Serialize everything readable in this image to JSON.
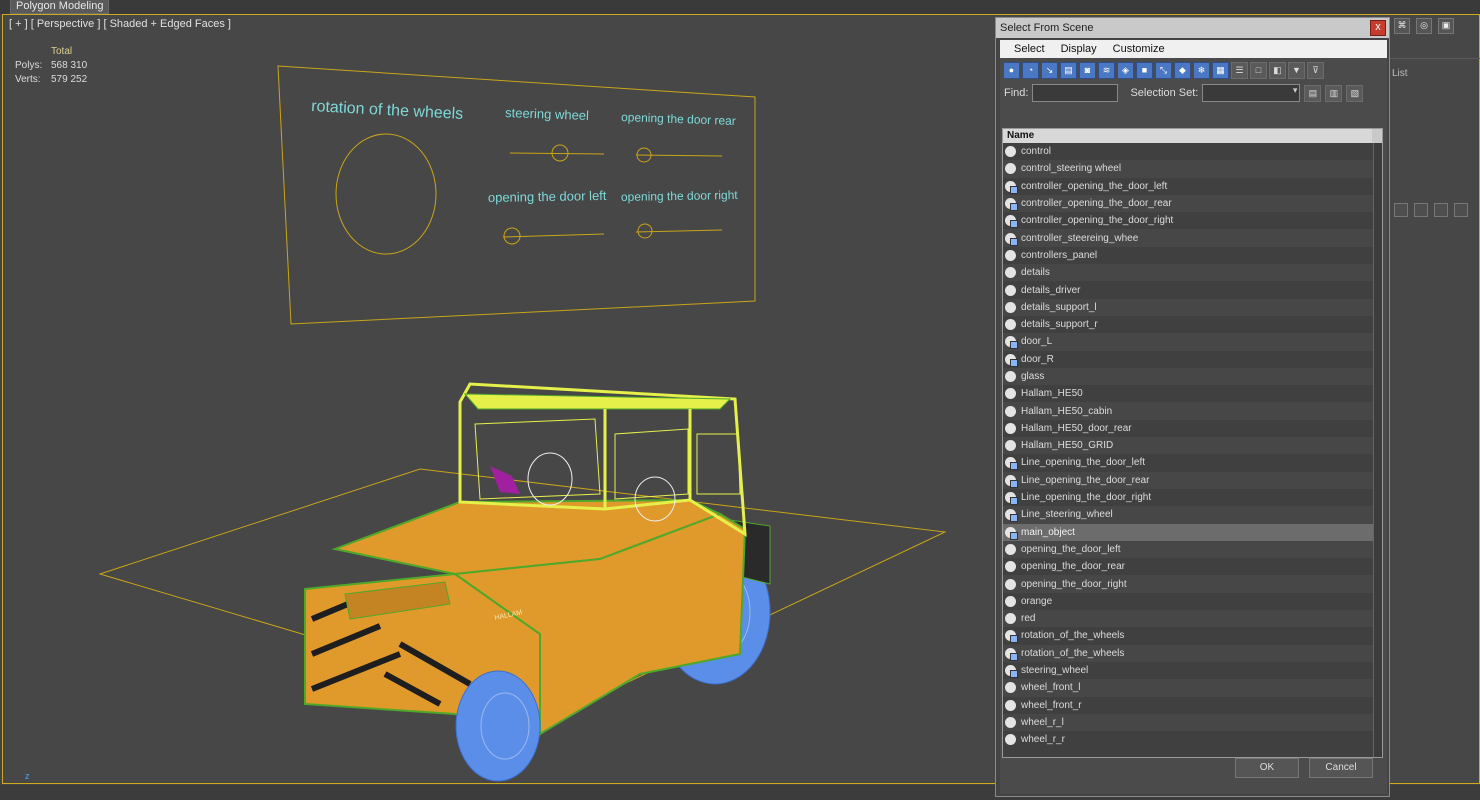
{
  "app": {
    "mode_tab": "Polygon Modeling"
  },
  "viewport": {
    "label": "[ + ] [ Perspective ] [ Shaded + Edged Faces ]",
    "stats": {
      "header": "Total",
      "polys_label": "Polys:",
      "polys_value": "568 310",
      "verts_label": "Verts:",
      "verts_value": "579 252"
    },
    "axis_label": "z",
    "panel_texts": {
      "rotation": "rotation of the wheels",
      "steering": "steering wheel",
      "door_rear": "opening the door rear",
      "door_left": "opening the door left",
      "door_right": "opening the door right"
    },
    "truck_brand": "HALLAM"
  },
  "right_panel": {
    "list_label": "List"
  },
  "dialog": {
    "title": "Select From Scene",
    "close_label": "x",
    "menu": [
      "Select",
      "Display",
      "Customize"
    ],
    "find_label": "Find:",
    "selection_set_label": "Selection Set:",
    "column_header": "Name",
    "selected_item": "main_object",
    "items": [
      {
        "name": "control",
        "icon": "sphere"
      },
      {
        "name": "control_steering wheel",
        "icon": "sphere"
      },
      {
        "name": "controller_opening_the_door_left",
        "icon": "shape"
      },
      {
        "name": "controller_opening_the_door_rear",
        "icon": "shape"
      },
      {
        "name": "controller_opening_the_door_right",
        "icon": "shape"
      },
      {
        "name": "controller_steereing_whee",
        "icon": "shape"
      },
      {
        "name": "controllers_panel",
        "icon": "sphere"
      },
      {
        "name": "details",
        "icon": "sphere"
      },
      {
        "name": "details_driver",
        "icon": "sphere"
      },
      {
        "name": "details_support_l",
        "icon": "sphere"
      },
      {
        "name": "details_support_r",
        "icon": "sphere"
      },
      {
        "name": "door_L",
        "icon": "shape"
      },
      {
        "name": "door_R",
        "icon": "shape"
      },
      {
        "name": "glass",
        "icon": "sphere"
      },
      {
        "name": "Hallam_HE50",
        "icon": "sphere"
      },
      {
        "name": "Hallam_HE50_cabin",
        "icon": "sphere"
      },
      {
        "name": "Hallam_HE50_door_rear",
        "icon": "sphere"
      },
      {
        "name": "Hallam_HE50_GRID",
        "icon": "sphere"
      },
      {
        "name": "Line_opening_the_door_left",
        "icon": "shape"
      },
      {
        "name": "Line_opening_the_door_rear",
        "icon": "shape"
      },
      {
        "name": "Line_opening_the_door_right",
        "icon": "shape"
      },
      {
        "name": "Line_steering_wheel",
        "icon": "shape"
      },
      {
        "name": "main_object",
        "icon": "shape"
      },
      {
        "name": "opening_the_door_left",
        "icon": "sphere"
      },
      {
        "name": "opening_the_door_rear",
        "icon": "sphere"
      },
      {
        "name": "opening_the_door_right",
        "icon": "sphere"
      },
      {
        "name": "orange",
        "icon": "sphere"
      },
      {
        "name": "red",
        "icon": "sphere"
      },
      {
        "name": "rotation_of_the_wheels",
        "icon": "shape"
      },
      {
        "name": "rotation_of_the_wheels",
        "icon": "shape"
      },
      {
        "name": "steering_wheel",
        "icon": "shape"
      },
      {
        "name": "wheel_front_l",
        "icon": "sphere"
      },
      {
        "name": "wheel_front_r",
        "icon": "sphere"
      },
      {
        "name": "wheel_r_l",
        "icon": "sphere"
      },
      {
        "name": "wheel_r_r",
        "icon": "sphere"
      }
    ],
    "ok_label": "OK",
    "cancel_label": "Cancel"
  },
  "colors": {
    "viewport_border": "#cfaa1a",
    "wire_yellow": "#e6f04a",
    "wire_green": "#4fa82a",
    "body_orange": "#e09a2c",
    "wheel_blue": "#5b8ee8",
    "panel_text": "#7fd8d8"
  }
}
